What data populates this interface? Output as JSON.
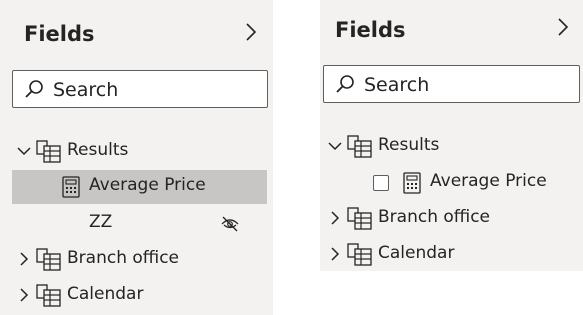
{
  "left_pane": {
    "title": "Fields",
    "search_placeholder": "Search",
    "tables": [
      {
        "label": "Results",
        "expanded": true,
        "fields": [
          {
            "label": "Average Price",
            "icon": "calculator-icon",
            "selected": true
          },
          {
            "label": "ZZ",
            "hidden": true,
            "icon": "eye-hidden-icon"
          }
        ]
      },
      {
        "label": "Branch office",
        "expanded": false
      },
      {
        "label": "Calendar",
        "expanded": false
      }
    ]
  },
  "right_pane": {
    "title": "Fields",
    "search_placeholder": "Search",
    "tables": [
      {
        "label": "Results",
        "expanded": true,
        "fields": [
          {
            "label": "Average Price",
            "icon": "calculator-icon",
            "checked": false
          }
        ]
      },
      {
        "label": "Branch office",
        "expanded": false
      },
      {
        "label": "Calendar",
        "expanded": false
      }
    ]
  },
  "colors": {
    "pane_background": "#f3f2f1",
    "selected_row": "#c8c6c4",
    "text": "#252423",
    "border": "#605e5c"
  }
}
